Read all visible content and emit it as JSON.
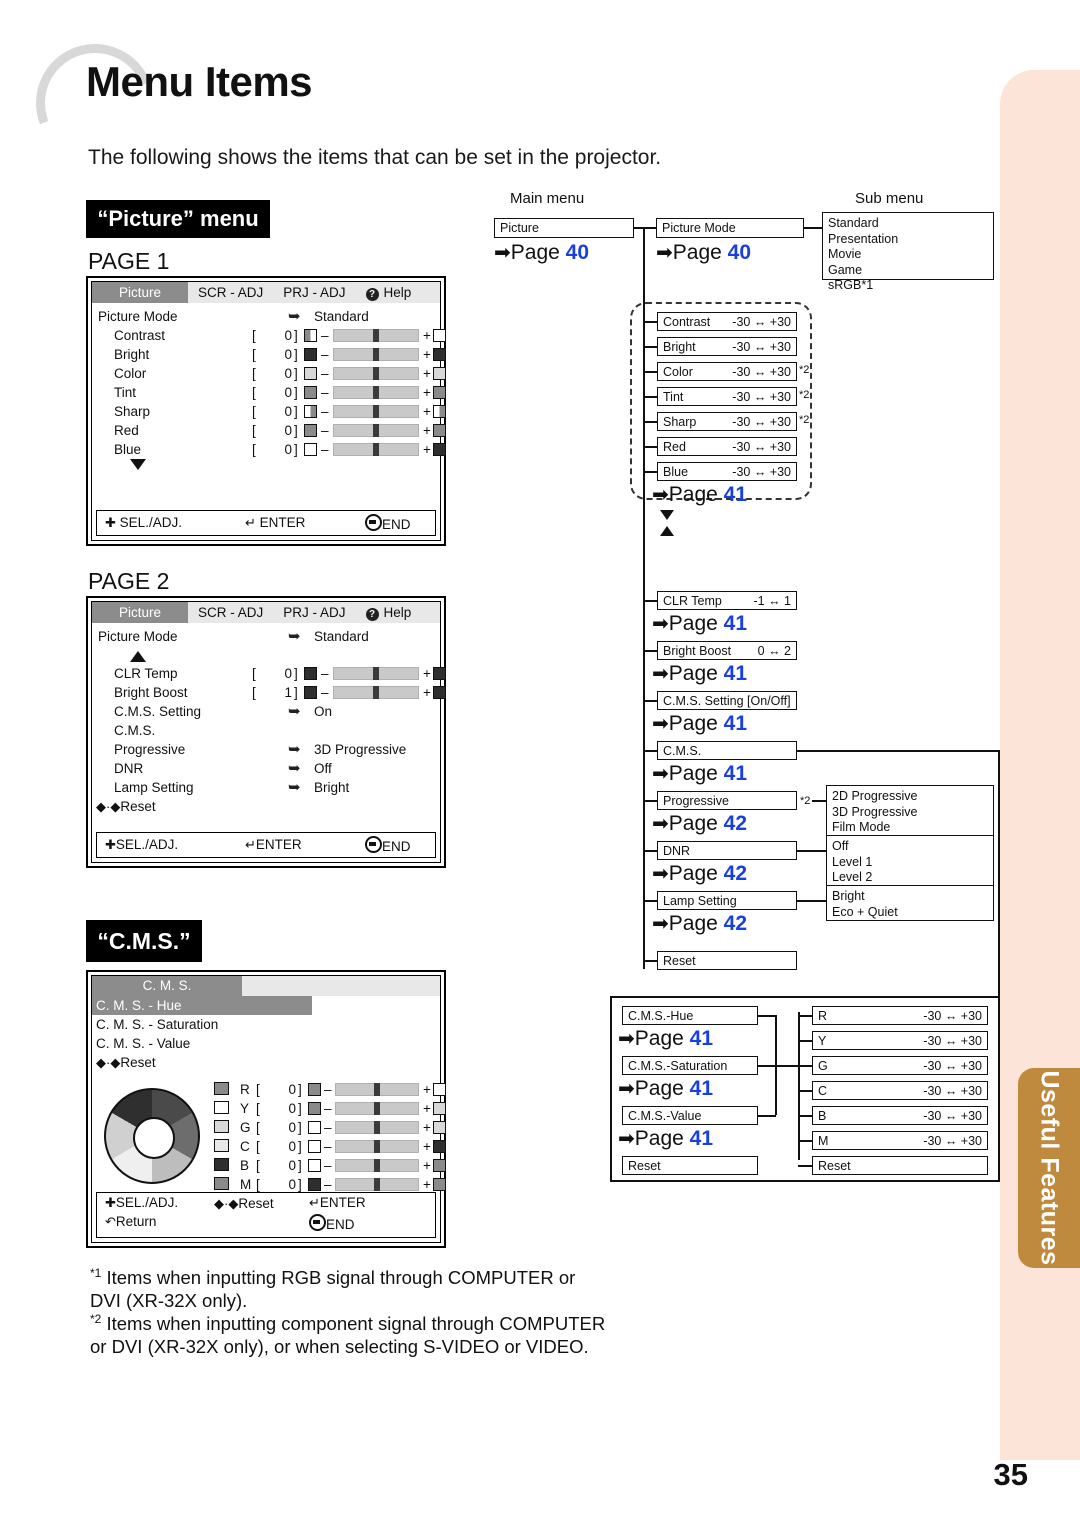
{
  "document": {
    "title": "Menu Items",
    "intro": "The following shows the items that can be set in the projector.",
    "page_number": "35",
    "side_tab": "Useful Features"
  },
  "sections": {
    "picture_chip": "“Picture” menu",
    "cms_chip": "“C.M.S.”",
    "page1_label": "PAGE 1",
    "page2_label": "PAGE 2"
  },
  "osd_tabs": {
    "picture": "Picture",
    "scr_adj": "SCR - ADJ",
    "prj_adj": "PRJ - ADJ",
    "help": "Help",
    "help_icon": "question-mark-icon"
  },
  "osd_footer": {
    "sel_adj": "SEL./ADJ.",
    "enter": "ENTER",
    "end": "END",
    "return": "Return"
  },
  "page1": {
    "picture_mode_label": "Picture Mode",
    "picture_mode_value": "Standard",
    "rows": [
      {
        "label": "Contrast",
        "value": "0"
      },
      {
        "label": "Bright",
        "value": "0"
      },
      {
        "label": "Color",
        "value": "0"
      },
      {
        "label": "Tint",
        "value": "0"
      },
      {
        "label": "Sharp",
        "value": "0"
      },
      {
        "label": "Red",
        "value": "0"
      },
      {
        "label": "Blue",
        "value": "0"
      }
    ],
    "bracket_open": "[",
    "bracket_close": "]",
    "minus": "–",
    "plus": "+"
  },
  "page2": {
    "picture_mode_label": "Picture Mode",
    "picture_mode_value": "Standard",
    "rows": [
      {
        "label": "CLR Temp",
        "value": "0"
      },
      {
        "label": "Bright Boost",
        "value": "1"
      }
    ],
    "items": [
      {
        "label": "C.M.S. Setting",
        "value": "On"
      },
      {
        "label": "C.M.S.",
        "value": ""
      },
      {
        "label": "Progressive",
        "value": "3D Progressive"
      },
      {
        "label": "DNR",
        "value": "Off"
      },
      {
        "label": "Lamp Setting",
        "value": "Bright"
      }
    ],
    "reset": "Reset"
  },
  "cms_osd": {
    "header": "C. M. S.",
    "selected": "C. M. S. - Hue",
    "items": [
      "C. M. S. - Saturation",
      "C. M. S. - Value"
    ],
    "reset_top": "Reset",
    "reset_bottom": "Reset",
    "rows": [
      {
        "label": "R",
        "value": "0"
      },
      {
        "label": "Y",
        "value": "0"
      },
      {
        "label": "G",
        "value": "0"
      },
      {
        "label": "C",
        "value": "0"
      },
      {
        "label": "B",
        "value": "0"
      },
      {
        "label": "M",
        "value": "0"
      }
    ]
  },
  "flow": {
    "main_menu_header": "Main menu",
    "sub_menu_header": "Sub menu",
    "picture_box": "Picture",
    "picture_page": "Page",
    "picture_page_num": "40",
    "picture_mode_box": "Picture Mode",
    "picture_mode_page": "Page",
    "picture_mode_page_num": "40",
    "picture_mode_options": "Standard\nPresentation\nMovie\nGame\nsRGB*1",
    "adjust_items": [
      {
        "label": "Contrast",
        "range": "-30 ↔ +30",
        "note": ""
      },
      {
        "label": "Bright",
        "range": "-30 ↔ +30",
        "note": ""
      },
      {
        "label": "Color",
        "range": "-30 ↔ +30",
        "note": "*2"
      },
      {
        "label": "Tint",
        "range": "-30 ↔ +30",
        "note": "*2"
      },
      {
        "label": "Sharp",
        "range": "-30 ↔ +30",
        "note": "*2"
      },
      {
        "label": "Red",
        "range": "-30 ↔ +30",
        "note": ""
      },
      {
        "label": "Blue",
        "range": "-30 ↔ +30",
        "note": ""
      }
    ],
    "adjust_page": "Page",
    "adjust_page_num": "41",
    "clr_temp": {
      "label": "CLR Temp",
      "range": "-1 ↔ 1",
      "page": "Page",
      "page_num": "41"
    },
    "bright_boost": {
      "label": "Bright Boost",
      "range": "0 ↔ 2",
      "page": "Page",
      "page_num": "41"
    },
    "cms_setting": {
      "label": "C.M.S. Setting [On/Off]",
      "page": "Page",
      "page_num": "41"
    },
    "cms": {
      "label": "C.M.S.",
      "page": "Page",
      "page_num": "41"
    },
    "progressive": {
      "label": "Progressive",
      "note": "*2",
      "options": "2D Progressive\n3D Progressive\nFilm Mode",
      "page": "Page",
      "page_num": "42"
    },
    "dnr": {
      "label": "DNR",
      "options": "Off\nLevel 1\nLevel 2",
      "page": "Page",
      "page_num": "42"
    },
    "lamp_setting": {
      "label": "Lamp Setting",
      "options": "Bright\nEco + Quiet",
      "page": "Page",
      "page_num": "42"
    },
    "reset": "Reset",
    "cms_group": {
      "hue": {
        "label": "C.M.S.-Hue",
        "page": "Page",
        "page_num": "41"
      },
      "saturation": {
        "label": "C.M.S.-Saturation",
        "page": "Page",
        "page_num": "41"
      },
      "value": {
        "label": "C.M.S.-Value",
        "page": "Page",
        "page_num": "41"
      },
      "reset": "Reset",
      "channels": [
        {
          "label": "R",
          "range": "-30 ↔ +30"
        },
        {
          "label": "Y",
          "range": "-30 ↔ +30"
        },
        {
          "label": "G",
          "range": "-30 ↔ +30"
        },
        {
          "label": "C",
          "range": "-30 ↔ +30"
        },
        {
          "label": "B",
          "range": "-30 ↔ +30"
        },
        {
          "label": "M",
          "range": "-30 ↔ +30"
        }
      ],
      "channels_reset": "Reset"
    }
  },
  "footnotes": {
    "one_marker": "*1",
    "one_text": "Items when inputting RGB signal through COMPUTER or DVI (XR-32X only).",
    "two_marker": "*2",
    "two_text": "Items when inputting component signal through COMPUTER or DVI (XR-32X only), or when selecting S-VIDEO or VIDEO."
  },
  "colors": {
    "page_ref_blue": "#1a3fe0",
    "tab_brown": "#c08a3e",
    "panel_peach": "#fce4d8",
    "osd_active_gray": "#8c8c8c"
  }
}
